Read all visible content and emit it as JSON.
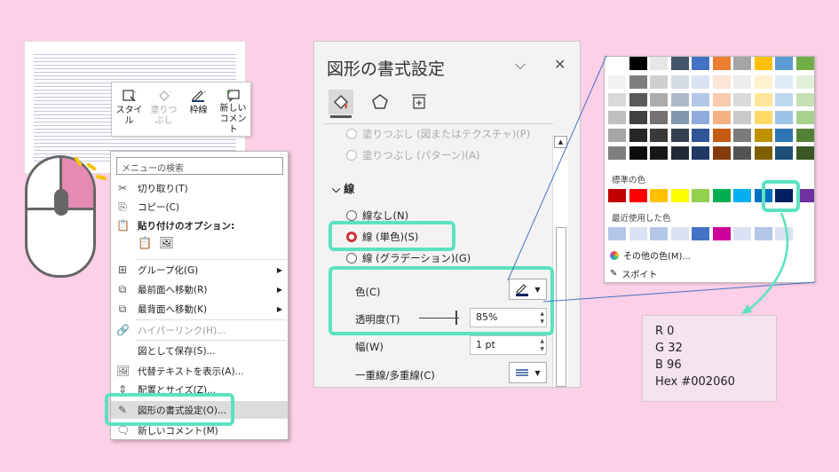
{
  "mini_toolbar": {
    "style": [
      "スタイ",
      "ル"
    ],
    "fill": [
      "塗りつ",
      "ぶし"
    ],
    "outline": "枠線",
    "new_comment": [
      "新しい",
      "コメント"
    ]
  },
  "context_menu": {
    "search_placeholder": "メニューの検索",
    "cut": "切り取り(T)",
    "copy": "コピー(C)",
    "paste_options": "貼り付けのオプション:",
    "group": "グループ化(G)",
    "bring_front": "最前面へ移動(R)",
    "send_back": "最背面へ移動(K)",
    "hyperlink": "ハイパーリンク(H)...",
    "save_as_picture": "図として保存(S)...",
    "alt_text": "代替テキストを表示(A)...",
    "size_position": "配置とサイズ(Z)...",
    "format_shape": "図形の書式設定(O)...",
    "new_comment": "新しいコメント(M)"
  },
  "pane": {
    "title": "図形の書式設定",
    "fill_pattern_cut": "塗りつぶし (図またはテクスチャ)(P)",
    "fill_pattern": "塗りつぶし (パターン)(A)",
    "line_section": "線",
    "no_line": "線なし(N)",
    "solid_line": "線 (単色)(S)",
    "gradient_line": "線 (グラデーション)(G)",
    "color_label": "色(C)",
    "transparency_label": "透明度(T)",
    "transparency_value": "85%",
    "width_label": "幅(W)",
    "width_value": "1 pt",
    "compound_label": "一重線/多重線(C)"
  },
  "palette": {
    "standard_colors_label": "標準の色",
    "recent_colors_label": "最近使用した色",
    "more_colors": "その他の色(M)...",
    "eyedropper": "スポイト",
    "theme_top": [
      "#ffffff",
      "#000000",
      "#e7e6e6",
      "#44546a",
      "#4472c4",
      "#ed7d31",
      "#a5a5a5",
      "#ffc000",
      "#5b9bd5",
      "#70ad47"
    ],
    "theme_shades": [
      [
        "#f2f2f2",
        "#7f7f7f",
        "#d0cece",
        "#d6dce5",
        "#dae3f3",
        "#fbe5d6",
        "#ededed",
        "#fff2cc",
        "#deebf7",
        "#e2f0d9"
      ],
      [
        "#d9d9d9",
        "#595959",
        "#aeabab",
        "#adb9ca",
        "#b4c7e7",
        "#f8cbad",
        "#dbdbdb",
        "#ffe699",
        "#bdd7ee",
        "#c5e0b4"
      ],
      [
        "#bfbfbf",
        "#404040",
        "#757171",
        "#8497b0",
        "#8faadc",
        "#f4b183",
        "#c9c9c9",
        "#ffd966",
        "#9dc3e6",
        "#a9d18e"
      ],
      [
        "#a6a6a6",
        "#262626",
        "#3b3838",
        "#333f50",
        "#2f5597",
        "#c55a11",
        "#7b7b7b",
        "#bf9000",
        "#2e75b6",
        "#538135"
      ],
      [
        "#7f7f7f",
        "#0d0d0d",
        "#171717",
        "#222a35",
        "#203864",
        "#843c0c",
        "#525252",
        "#7f6000",
        "#1f4e79",
        "#385723"
      ]
    ],
    "standard": [
      "#c00000",
      "#ff0000",
      "#ffc000",
      "#ffff00",
      "#92d050",
      "#00b050",
      "#00b0f0",
      "#0070c0",
      "#002060",
      "#7030a0"
    ],
    "recent": [
      "#b4c7e7",
      "#dae3f3",
      "#b4c7e7",
      "#dae3f3",
      "#4472c4",
      "#cc0099",
      "#dae3f3",
      "#b4c7e7",
      "#dae3f3"
    ],
    "accent": "#5ce2c0"
  },
  "rgb_info": {
    "r": "R  0",
    "g": "G 32",
    "b": "B 96",
    "hex": "Hex  #002060"
  }
}
